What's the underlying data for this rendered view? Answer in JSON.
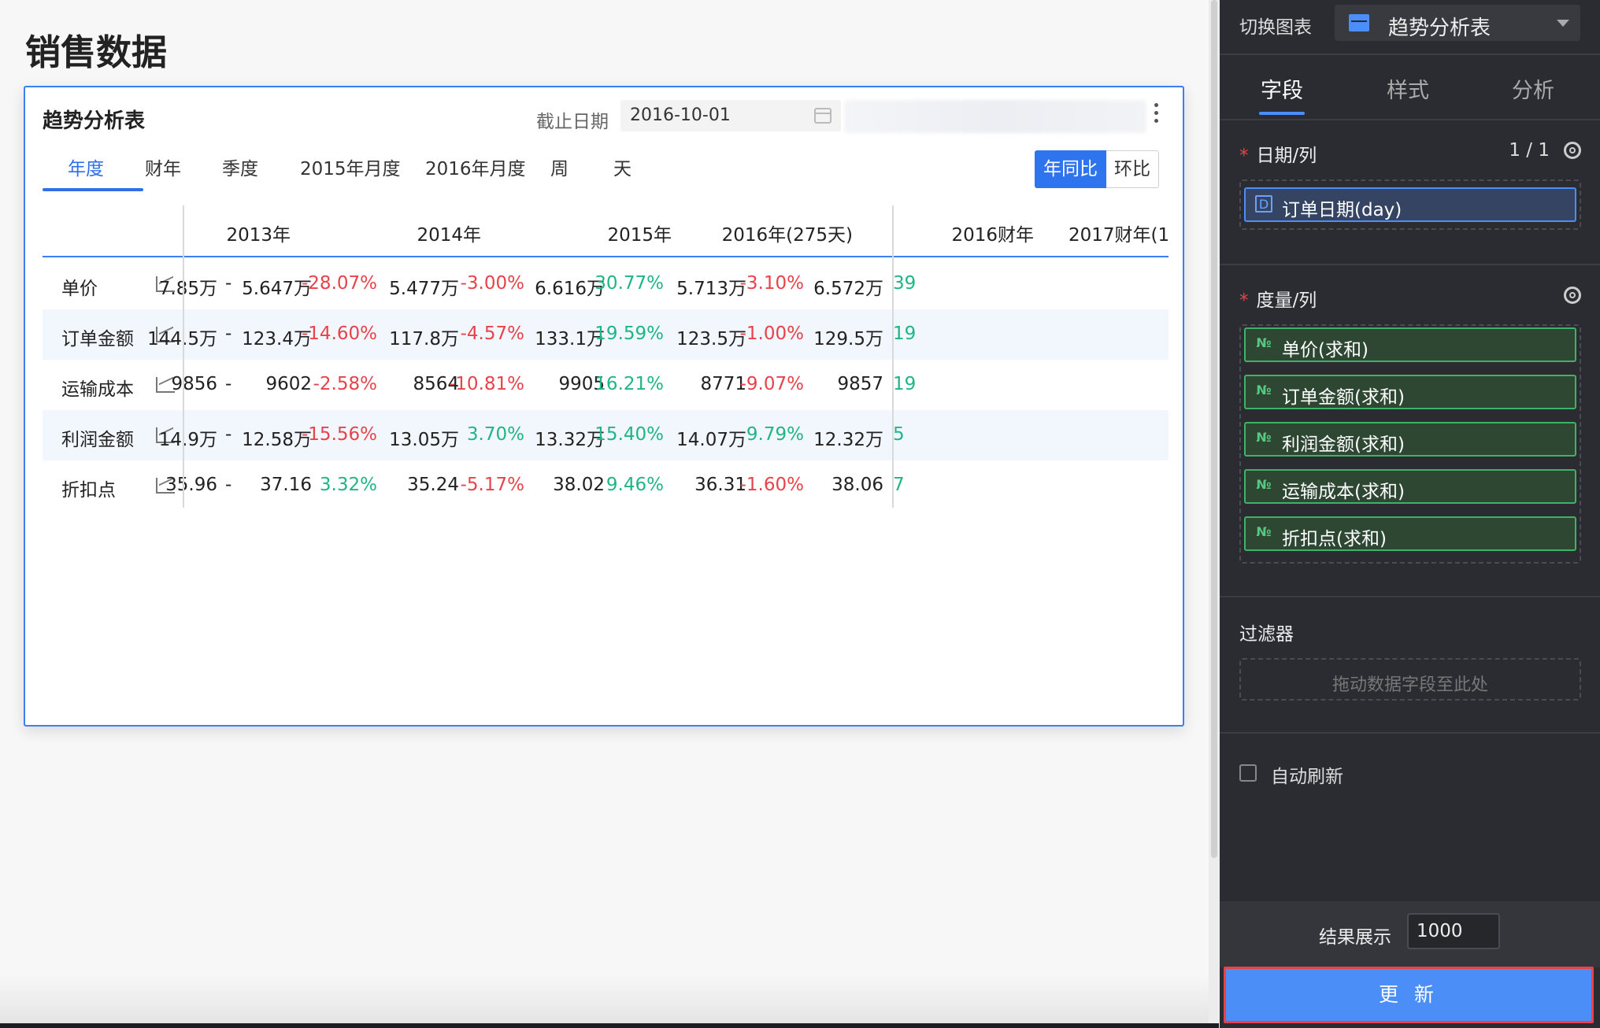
{
  "page_title": "销售数据",
  "card": {
    "title": "趋势分析表",
    "date_label": "截止日期",
    "date_value": "2016-10-01",
    "tabs": [
      "年度",
      "财年",
      "季度",
      "2015年月度",
      "2016年月度",
      "周",
      "天"
    ],
    "active_tab": "年度",
    "compare_on": "年同比",
    "compare_off": "环比"
  },
  "table": {
    "headers": [
      "2013年",
      "2014年",
      "2015年",
      "2016年(275天)",
      "2016财年",
      "2017财年(1"
    ],
    "rows": [
      {
        "label": "单价",
        "cells": [
          [
            "7.85万",
            "-",
            "dash"
          ],
          [
            "5.647万",
            "-28.07%",
            "red"
          ],
          [
            "5.477万",
            "-3.00%",
            "red"
          ],
          [
            "6.616万",
            "30.77%",
            "green"
          ],
          [
            "5.713万",
            "-3.10%",
            "red"
          ],
          [
            "6.572万",
            "39",
            "green"
          ]
        ]
      },
      {
        "label": "订单金额",
        "cells": [
          [
            "144.5万",
            "-",
            "dash"
          ],
          [
            "123.4万",
            "-14.60%",
            "red"
          ],
          [
            "117.8万",
            "-4.57%",
            "red"
          ],
          [
            "133.1万",
            "19.59%",
            "green"
          ],
          [
            "123.5万",
            "-1.00%",
            "red"
          ],
          [
            "129.5万",
            "19",
            "green"
          ]
        ]
      },
      {
        "label": "运输成本",
        "cells": [
          [
            "9856",
            "-",
            "dash"
          ],
          [
            "9602",
            "-2.58%",
            "red"
          ],
          [
            "8564",
            "-10.81%",
            "red"
          ],
          [
            "9905",
            "16.21%",
            "green"
          ],
          [
            "8771",
            "-9.07%",
            "red"
          ],
          [
            "9857",
            "19",
            "green"
          ]
        ]
      },
      {
        "label": "利润金额",
        "cells": [
          [
            "14.9万",
            "-",
            "dash"
          ],
          [
            "12.58万",
            "-15.56%",
            "red"
          ],
          [
            "13.05万",
            "3.70%",
            "green"
          ],
          [
            "13.32万",
            "15.40%",
            "green"
          ],
          [
            "14.07万",
            "9.79%",
            "green"
          ],
          [
            "12.32万",
            "5",
            "green"
          ]
        ]
      },
      {
        "label": "折扣点",
        "cells": [
          [
            "35.96",
            "-",
            "dash"
          ],
          [
            "37.16",
            "3.32%",
            "green"
          ],
          [
            "35.24",
            "-5.17%",
            "red"
          ],
          [
            "38.02",
            "9.46%",
            "green"
          ],
          [
            "36.31",
            "-1.60%",
            "red"
          ],
          [
            "38.06",
            "7",
            "green"
          ]
        ]
      }
    ]
  },
  "panel": {
    "switch_label": "切换图表",
    "chart_type": "趋势分析表",
    "tabs": [
      "字段",
      "样式",
      "分析"
    ],
    "date_section": {
      "title": "日期/列",
      "count": "1 / 1",
      "field": "订单日期(day)"
    },
    "measure_section": {
      "title": "度量/列",
      "fields": [
        "单价(求和)",
        "订单金额(求和)",
        "利润金额(求和)",
        "运输成本(求和)",
        "折扣点(求和)"
      ]
    },
    "filter_section": {
      "title": "过滤器",
      "hint": "拖动数据字段至此处"
    },
    "auto_refresh": "自动刷新",
    "result_label": "结果展示",
    "result_value": "1000",
    "update_button": "更 新"
  },
  "colors": {
    "accent": "#2f6fe8",
    "up": "#1fb584",
    "down": "#e8424a",
    "panel_bg": "#2b2c31"
  },
  "icons": {
    "calendar": "calendar-icon",
    "more": "more-icon",
    "trend": "trend-chart-icon",
    "gear": "gear-icon",
    "date_field": "date-field-icon",
    "number_field": "number-field-icon"
  }
}
